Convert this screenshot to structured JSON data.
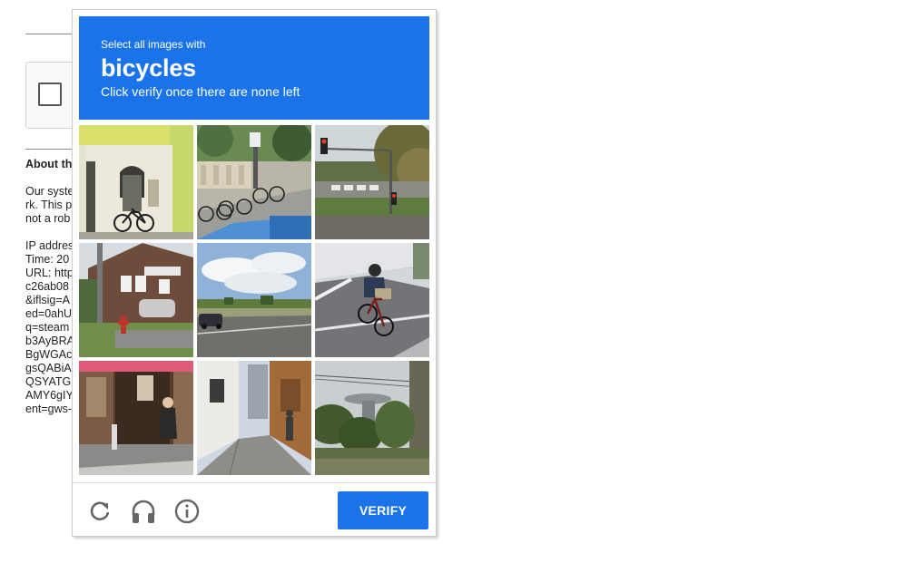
{
  "background_page": {
    "about_heading": "About th",
    "body_lines": [
      "Our syste",
      "rk. This p",
      "not a rob",
      "",
      "IP addres",
      "Time: 20",
      "URL: http",
      "c26ab08",
      "&iflsig=A",
      "ed=0ahU",
      "q=steam",
      "b3AyBRA",
      "BgWGAc",
      "gsQABiA",
      "QSYATG",
      "AMY6gIY",
      "ent=gws-"
    ]
  },
  "challenge": {
    "prompt": {
      "line1": "Select all images with",
      "keyword": "bicycles",
      "line3": "Click verify once there are none left"
    },
    "tiles": [
      {
        "scene": "doorway-with-bicycle"
      },
      {
        "scene": "parked-bicycles-by-road"
      },
      {
        "scene": "traffic-light-road"
      },
      {
        "scene": "brick-building-hydrant"
      },
      {
        "scene": "open-road-sky"
      },
      {
        "scene": "person-riding-bicycle"
      },
      {
        "scene": "shop-front-person"
      },
      {
        "scene": "narrow-alley"
      },
      {
        "scene": "observation-tower-trees"
      }
    ],
    "footer": {
      "verify_label": "VERIFY",
      "reload_icon": "reload-icon",
      "audio_icon": "headphones-icon",
      "info_icon": "info-icon"
    }
  },
  "colors": {
    "accent": "#1a73e8",
    "icon_gray": "#666666"
  }
}
